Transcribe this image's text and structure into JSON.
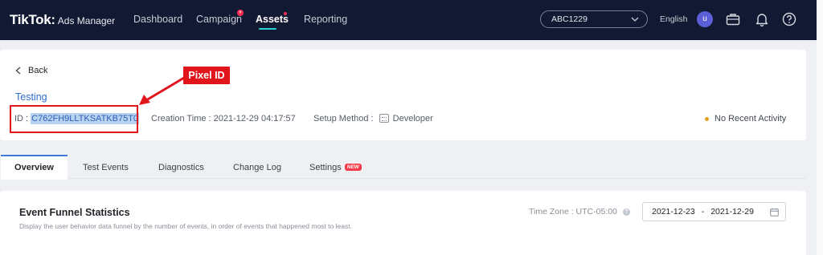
{
  "brand": {
    "logo": "TikTok",
    "separator": ":",
    "product": "Ads Manager"
  },
  "nav": {
    "items": [
      {
        "label": "Dashboard",
        "active": false
      },
      {
        "label": "Campaign",
        "active": false,
        "badge": "+"
      },
      {
        "label": "Assets",
        "active": true,
        "dot": true
      },
      {
        "label": "Reporting",
        "active": false
      }
    ]
  },
  "account": {
    "selected": "ABC1229"
  },
  "language": "English",
  "user": {
    "initial": "u"
  },
  "back": {
    "label": "Back"
  },
  "pixel": {
    "name": "Testing",
    "id_label": "ID : ",
    "id_value": "C762FH9LLTKSATKB75T0",
    "creation_label": "Creation Time : ",
    "creation_value": "2021-12-29 04:17:57",
    "setup_label": "Setup Method : ",
    "setup_value": "Developer",
    "status": "No Recent Activity"
  },
  "annotation": {
    "label": "Pixel ID"
  },
  "tabs": [
    {
      "label": "Overview",
      "active": true
    },
    {
      "label": "Test Events",
      "active": false
    },
    {
      "label": "Diagnostics",
      "active": false
    },
    {
      "label": "Change Log",
      "active": false
    },
    {
      "label": "Settings",
      "active": false,
      "badge": "NEW"
    }
  ],
  "funnel": {
    "title": "Event Funnel Statistics",
    "description": "Display the user behavior data funnel by the number of events, in order of events that happened most to least.",
    "timezone_label": "Time Zone : UTC-05:00",
    "help": "?",
    "date_start": "2021-12-23",
    "date_sep": "-",
    "date_end": "2021-12-29"
  },
  "colors": {
    "navbar": "#121a33",
    "accent_cyan": "#2bd4d4",
    "link_blue": "#2d6fd1",
    "annotation_red": "#e0161c",
    "status_yellow": "#e0a020"
  }
}
